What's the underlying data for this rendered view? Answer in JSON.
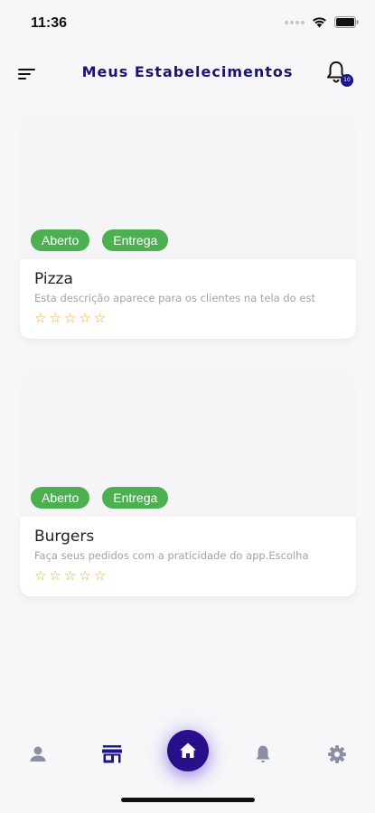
{
  "status_bar": {
    "time": "11:36"
  },
  "header": {
    "title": "Meus Estabelecimentos",
    "notification_count": "10"
  },
  "establishments": [
    {
      "name": "Pizza",
      "description": "Esta descrição aparece para os clientes na tela do est",
      "tags": [
        "Aberto",
        "Entrega"
      ],
      "rating": 0,
      "max_rating": 5
    },
    {
      "name": "Burgers",
      "description": "Faça seus pedidos com a praticidade do app.Escolha",
      "tags": [
        "Aberto",
        "Entrega"
      ],
      "rating": 0,
      "max_rating": 5
    }
  ],
  "bottom_nav": {
    "items": [
      {
        "icon": "person-icon",
        "active": false
      },
      {
        "icon": "store-icon",
        "active": true
      },
      {
        "icon": "home-icon",
        "active": false
      },
      {
        "icon": "bell-icon",
        "active": false
      },
      {
        "icon": "gear-icon",
        "active": false
      }
    ]
  },
  "colors": {
    "accent": "#2a0f8a",
    "title": "#1a1570",
    "tag_green": "#4caf50",
    "star": "#f5a623",
    "nav_inactive": "#8a8fa3"
  }
}
